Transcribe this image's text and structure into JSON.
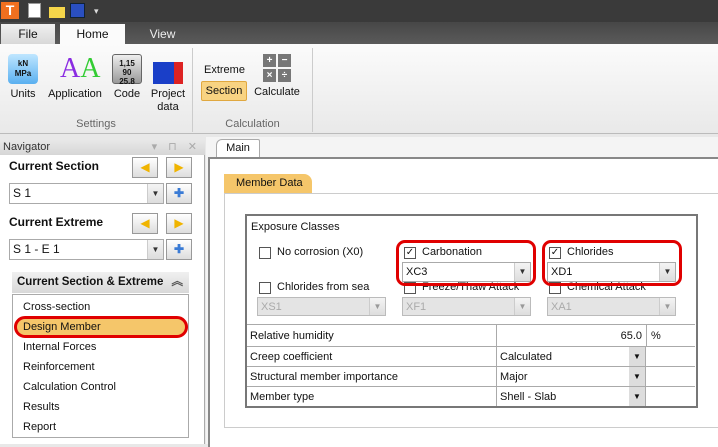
{
  "quick_access": {
    "icons": [
      "app-logo-icon",
      "new-file-icon",
      "open-folder-icon",
      "save-icon",
      "customize-icon"
    ]
  },
  "ribbon": {
    "tabs": [
      {
        "label": "File"
      },
      {
        "label": "Home"
      },
      {
        "label": "View"
      }
    ],
    "active_tab": "Home",
    "settings": {
      "label": "Settings",
      "buttons": [
        {
          "label": "Units"
        },
        {
          "label": "Application"
        },
        {
          "label": "Code"
        },
        {
          "label": "Project data"
        }
      ]
    },
    "calculation": {
      "label": "Calculation",
      "extreme": "Extreme",
      "section": "Section",
      "calculate": "Calculate"
    }
  },
  "navigator": {
    "title": "Navigator",
    "current_section": {
      "label": "Current Section",
      "value": "S 1"
    },
    "current_extreme": {
      "label": "Current Extreme",
      "value": "S 1 - E 1"
    },
    "group_title": "Current Section & Extreme",
    "items": [
      {
        "label": "Cross-section"
      },
      {
        "label": "Design Member"
      },
      {
        "label": "Internal Forces"
      },
      {
        "label": "Reinforcement"
      },
      {
        "label": "Calculation Control"
      },
      {
        "label": "Results"
      },
      {
        "label": "Report"
      }
    ],
    "selected": "Design Member"
  },
  "main": {
    "tab": "Main",
    "subtab": "Member Data",
    "exposure": {
      "title": "Exposure Classes",
      "no_corrosion": {
        "label": "No corrosion (X0)",
        "checked": false
      },
      "carbonation": {
        "label": "Carbonation",
        "checked": true,
        "value": "XC3"
      },
      "chlorides": {
        "label": "Chlorides",
        "checked": true,
        "value": "XD1"
      },
      "chlorides_sea": {
        "label": "Chlorides from sea",
        "checked": false,
        "value": "XS1"
      },
      "freeze": {
        "label": "Freeze/Thaw Attack",
        "checked": false,
        "value": "XF1"
      },
      "chemical": {
        "label": "Chemical Attack",
        "checked": false,
        "value": "XA1"
      }
    },
    "rows": [
      {
        "label": "Relative humidity",
        "value": "65.0",
        "unit": "%"
      },
      {
        "label": "Creep coefficient",
        "value": "Calculated"
      },
      {
        "label": "Structural member importance",
        "value": "Major"
      },
      {
        "label": "Member type",
        "value": "Shell - Slab"
      }
    ]
  },
  "colors": {
    "accent": "#f5c66a",
    "highlight": "#e00000"
  }
}
